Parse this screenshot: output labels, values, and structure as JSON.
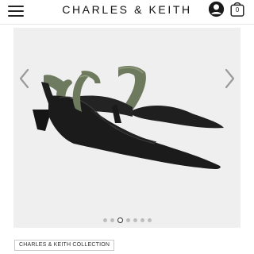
{
  "header": {
    "brand": "CHARLES & KEITH",
    "menu_icon": "hamburger-menu-icon",
    "account_icon": "user-account-icon",
    "bag_icon": "shopping-bag-icon",
    "bag_count": "0"
  },
  "gallery": {
    "image_description": "black-pointed-toe-slingback-flats-with-olive-green-strap",
    "prev_icon": "chevron-left-icon",
    "next_icon": "chevron-right-icon",
    "dot_count": 7,
    "active_index": 2
  },
  "collection": {
    "label": "CHARLES & KEITH COLLECTION"
  },
  "colors": {
    "gallery_bg": "#efefef",
    "shoe_black": "#1b1b1b",
    "strap_green": "#6e7a5e",
    "text": "#111111"
  }
}
